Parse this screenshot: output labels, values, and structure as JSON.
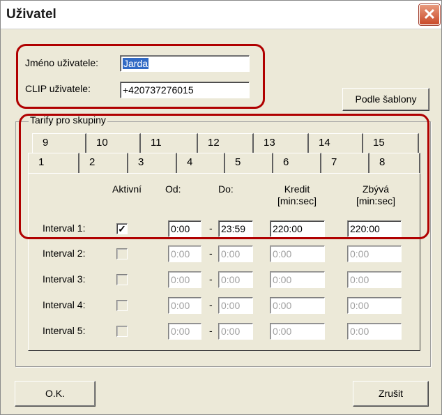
{
  "window": {
    "title": "Uživatel",
    "close_glyph": "✕"
  },
  "user": {
    "name_label": "Jméno uživatele:",
    "name_value": "Jarda",
    "clip_label": "CLIP uživatele:",
    "clip_value": "+420737276015"
  },
  "template_button": "Podle šablony",
  "group": {
    "title": "Tarify pro skupiny"
  },
  "tabs": {
    "row1": [
      "9",
      "10",
      "11",
      "12",
      "13",
      "14",
      "15"
    ],
    "row2": [
      "1",
      "2",
      "3",
      "4",
      "5",
      "6",
      "7",
      "8"
    ],
    "selected": "1"
  },
  "headers": {
    "active": "Aktivní",
    "from": "Od:",
    "to": "Do:",
    "credit": "Kredit",
    "credit_unit": "[min:sec]",
    "remaining": "Zbývá",
    "remaining_unit": "[min:sec]"
  },
  "intervals": [
    {
      "label": "Interval 1:",
      "active": true,
      "from": "0:00",
      "to": "23:59",
      "credit": "220:00",
      "remaining": "220:00",
      "enabled": true
    },
    {
      "label": "Interval 2:",
      "active": false,
      "from": "0:00",
      "to": "0:00",
      "credit": "0:00",
      "remaining": "0:00",
      "enabled": false
    },
    {
      "label": "Interval 3:",
      "active": false,
      "from": "0:00",
      "to": "0:00",
      "credit": "0:00",
      "remaining": "0:00",
      "enabled": false
    },
    {
      "label": "Interval 4:",
      "active": false,
      "from": "0:00",
      "to": "0:00",
      "credit": "0:00",
      "remaining": "0:00",
      "enabled": false
    },
    {
      "label": "Interval 5:",
      "active": false,
      "from": "0:00",
      "to": "0:00",
      "credit": "0:00",
      "remaining": "0:00",
      "enabled": false
    }
  ],
  "separator": "-",
  "check_glyph": "✓",
  "buttons": {
    "ok": "O.K.",
    "cancel": "Zrušit"
  },
  "colors": {
    "annotation": "#b00000",
    "selection": "#316ac5"
  }
}
